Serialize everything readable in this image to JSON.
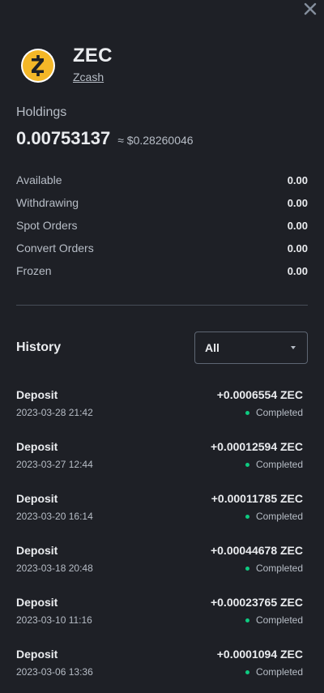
{
  "coin": {
    "symbol": "ZEC",
    "name": "Zcash",
    "logo_icon": "zcash-logo",
    "logo_color": "#f4b728"
  },
  "holdings": {
    "label": "Holdings",
    "amount": "0.00753137",
    "fiat": "≈ $0.28260046"
  },
  "balances": [
    {
      "label": "Available",
      "value": "0.00"
    },
    {
      "label": "Withdrawing",
      "value": "0.00"
    },
    {
      "label": "Spot Orders",
      "value": "0.00"
    },
    {
      "label": "Convert Orders",
      "value": "0.00"
    },
    {
      "label": "Frozen",
      "value": "0.00"
    }
  ],
  "history": {
    "title": "History",
    "filter": {
      "selected": "All"
    },
    "items": [
      {
        "type": "Deposit",
        "date": "2023-03-28 21:42",
        "amount": "+0.0006554 ZEC",
        "status": "Completed"
      },
      {
        "type": "Deposit",
        "date": "2023-03-27 12:44",
        "amount": "+0.00012594 ZEC",
        "status": "Completed"
      },
      {
        "type": "Deposit",
        "date": "2023-03-20 16:14",
        "amount": "+0.00011785 ZEC",
        "status": "Completed"
      },
      {
        "type": "Deposit",
        "date": "2023-03-18 20:48",
        "amount": "+0.00044678 ZEC",
        "status": "Completed"
      },
      {
        "type": "Deposit",
        "date": "2023-03-10 11:16",
        "amount": "+0.00023765 ZEC",
        "status": "Completed"
      },
      {
        "type": "Deposit",
        "date": "2023-03-06 13:36",
        "amount": "+0.0001094 ZEC",
        "status": "Completed"
      }
    ]
  },
  "colors": {
    "background": "#1e2026",
    "text_primary": "#eaecef",
    "text_secondary": "#b7bdc6",
    "status_completed": "#0ecb81",
    "divider": "#474d57"
  }
}
